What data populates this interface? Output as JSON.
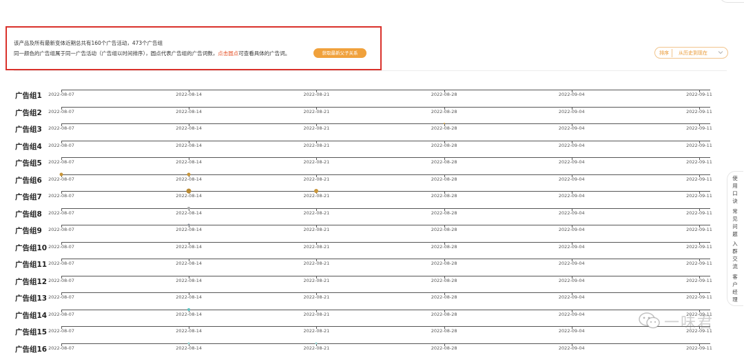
{
  "header": {
    "line1": "该产品及所有最新变体近期总共有160个广告活动，473个广告组",
    "line2_prefix": "同一颜色的广告组属于同一广告活动（广告组以时间排序），圆点代表广告组的广告词数，",
    "line2_highlight": "点击圆点",
    "line2_suffix": "可查看具体的广告词。",
    "button_label": "获取最新父子关系"
  },
  "sort": {
    "label": "排序",
    "value": "从历史到现在"
  },
  "timeline": {
    "dates": [
      "2022-08-07",
      "2022-08-14",
      "2022-08-21",
      "2022-08-28",
      "2022-09-04",
      "2022-09-11"
    ],
    "groups": [
      {
        "label": "广告组1",
        "dots": []
      },
      {
        "label": "广告组2",
        "dots": []
      },
      {
        "label": "广告组3",
        "dots": [
          {
            "date_index": 3,
            "size": 2,
            "color": "#d9a43b"
          }
        ]
      },
      {
        "label": "广告组4",
        "dots": []
      },
      {
        "label": "广告组5",
        "dots": []
      },
      {
        "label": "广告组6",
        "dots": [
          {
            "date_index": 0,
            "size": 5,
            "color": "#c9963a"
          },
          {
            "date_index": 1,
            "size": 5,
            "color": "#c9963a"
          }
        ]
      },
      {
        "label": "广告组7",
        "dots": [
          {
            "date_index": 1,
            "size": 7,
            "color": "#b98a34"
          },
          {
            "date_index": 2,
            "size": 6,
            "color": "#c9963a"
          }
        ]
      },
      {
        "label": "广告组8",
        "dots": [
          {
            "date_index": 1,
            "size": 4,
            "color": "#a9a9a9"
          }
        ]
      },
      {
        "label": "广告组9",
        "dots": [
          {
            "date_index": 1,
            "size": 3,
            "color": "#8a8f99"
          }
        ]
      },
      {
        "label": "广告组10",
        "dots": []
      },
      {
        "label": "广告组11",
        "dots": []
      },
      {
        "label": "广告组12",
        "dots": []
      },
      {
        "label": "广告组13",
        "dots": []
      },
      {
        "label": "广告组14",
        "dots": [
          {
            "date_index": 1,
            "size": 4,
            "color": "#5cc2c0"
          }
        ]
      },
      {
        "label": "广告组15",
        "dots": []
      },
      {
        "label": "广告组16",
        "dots": [
          {
            "date_index": 1,
            "size": 3,
            "color": "#9ad6d4"
          },
          {
            "date_index": 2,
            "size": 3,
            "color": "#9ad6d4"
          }
        ]
      }
    ]
  },
  "side_panel": {
    "items": [
      "使用口诀",
      "常见问题",
      "入群交流",
      "客户经理"
    ]
  },
  "watermark": {
    "text": "一味君"
  },
  "colors": {
    "accent": "#f0a13c",
    "highlight_red": "#e5532a",
    "box_border": "#d9302a"
  }
}
